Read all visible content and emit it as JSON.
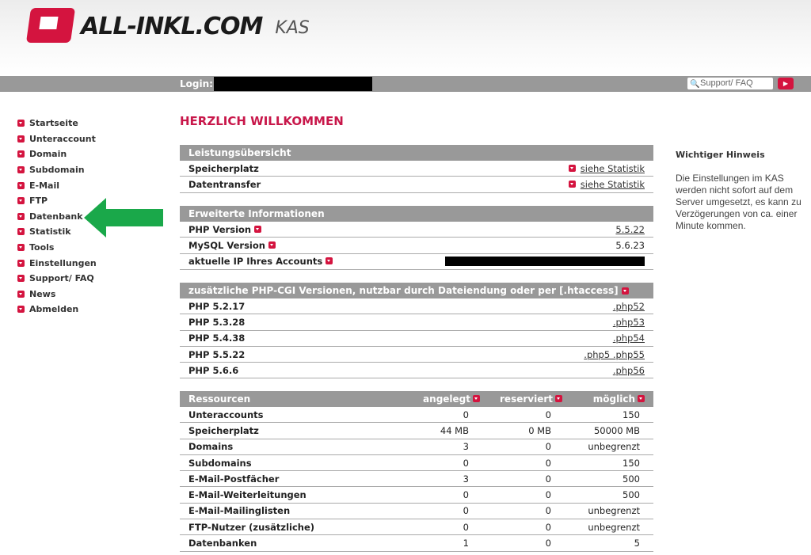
{
  "brand": {
    "logo": "ALL-INKL.COM",
    "product": "KAS",
    "accent": "#d4143f"
  },
  "topbar": {
    "login_label": "Login:",
    "search_placeholder": "Support/ FAQ"
  },
  "nav": [
    "Startseite",
    "Unteraccount",
    "Domain",
    "Subdomain",
    "E-Mail",
    "FTP",
    "Datenbank",
    "Statistik",
    "Tools",
    "Einstellungen",
    "Support/ FAQ",
    "News",
    "Abmelden"
  ],
  "page_title": "HERZLICH WILLKOMMEN",
  "leistung": {
    "title": "Leistungsübersicht",
    "rows": [
      {
        "label": "Speicherplatz",
        "link": "siehe Statistik"
      },
      {
        "label": "Datentransfer",
        "link": "siehe Statistik"
      }
    ]
  },
  "erweitert": {
    "title": "Erweiterte Informationen",
    "rows": [
      {
        "label": "PHP Version",
        "value": "5.5.22"
      },
      {
        "label": "MySQL Version",
        "value": "5.6.23"
      },
      {
        "label": "aktuelle IP Ihres Accounts",
        "value": ""
      }
    ]
  },
  "cgi": {
    "title": "zusätzliche PHP-CGI Versionen, nutzbar durch Dateiendung oder per [.htaccess]",
    "rows": [
      {
        "label": "PHP 5.2.17",
        "value": ".php52"
      },
      {
        "label": "PHP 5.3.28",
        "value": ".php53"
      },
      {
        "label": "PHP 5.4.38",
        "value": ".php54"
      },
      {
        "label": "PHP 5.5.22",
        "value": ".php5 .php55"
      },
      {
        "label": "PHP 5.6.6",
        "value": ".php56"
      }
    ]
  },
  "ressourcen": {
    "headers": [
      "Ressourcen",
      "angelegt",
      "reserviert",
      "möglich"
    ],
    "rows": [
      [
        "Unteraccounts",
        "0",
        "0",
        "150"
      ],
      [
        "Speicherplatz",
        "44 MB",
        "0 MB",
        "50000 MB"
      ],
      [
        "Domains",
        "3",
        "0",
        "unbegrenzt"
      ],
      [
        "Subdomains",
        "0",
        "0",
        "150"
      ],
      [
        "E-Mail-Postfächer",
        "3",
        "0",
        "500"
      ],
      [
        "E-Mail-Weiterleitungen",
        "0",
        "0",
        "500"
      ],
      [
        "E-Mail-Mailinglisten",
        "0",
        "0",
        "unbegrenzt"
      ],
      [
        "FTP-Nutzer (zusätzliche)",
        "0",
        "0",
        "unbegrenzt"
      ],
      [
        "Datenbanken",
        "1",
        "0",
        "5"
      ]
    ]
  },
  "notice": {
    "title": "Wichtiger Hinweis",
    "text": "Die Einstellungen im KAS werden nicht sofort auf dem Server umgesetzt, es kann zu Verzögerungen von ca. einer Minute kommen."
  },
  "annotation": {
    "arrow_color": "#1aa84a",
    "points_to": "Datenbank"
  }
}
